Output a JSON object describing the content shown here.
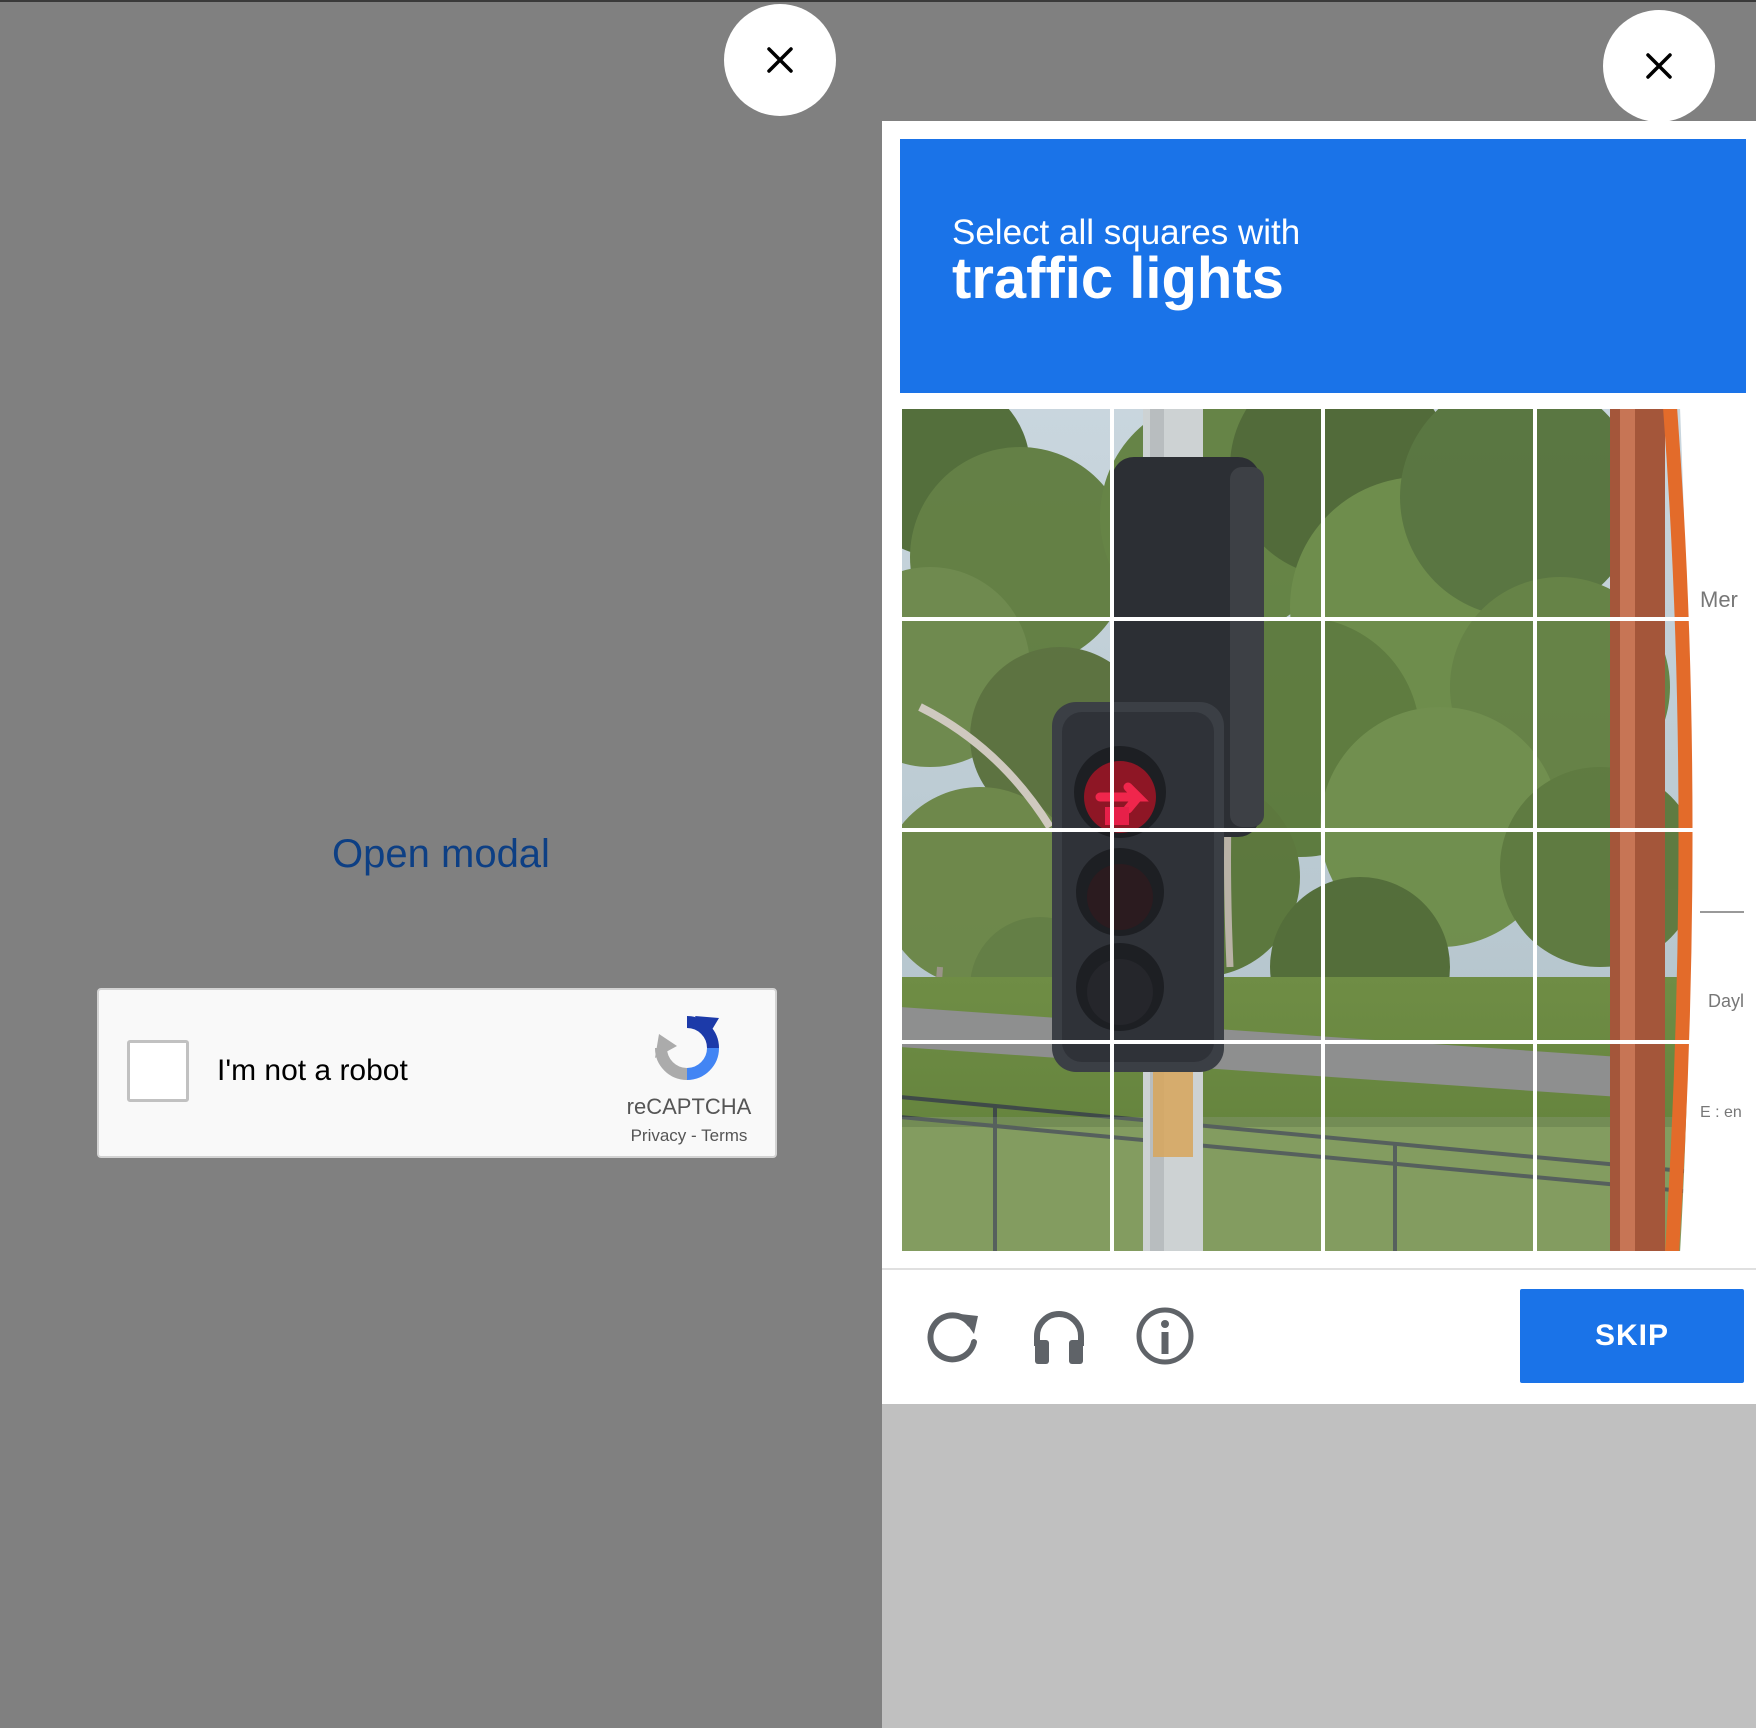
{
  "page": {
    "open_modal_link": "Open modal"
  },
  "left_modal": {
    "close_label": "close"
  },
  "recaptcha_widget": {
    "checkbox_label": "I'm not a robot",
    "brand": "reCAPTCHA",
    "privacy_link": "Privacy",
    "separator": "-",
    "terms_link": "Terms"
  },
  "challenge": {
    "instruction_prefix": "Select all squares with",
    "target": "traffic lights",
    "grid": {
      "rows": 4,
      "cols": 4,
      "selected": []
    },
    "footer": {
      "reload_icon": "reload-icon",
      "audio_icon": "headphones-icon",
      "info_icon": "info-icon",
      "skip_label": "SKIP"
    },
    "colors": {
      "header_blue": "#1a73e8",
      "skip_button": "#1a73e8"
    }
  }
}
